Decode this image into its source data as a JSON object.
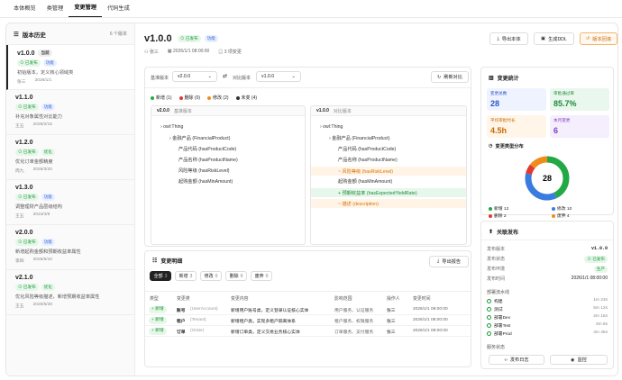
{
  "nav": {
    "tabs": [
      "本体概览",
      "类管理",
      "变更管理",
      "代码生成"
    ]
  },
  "sidebar": {
    "title": "版本历史",
    "count": "6 个版本",
    "versions": [
      {
        "name": "v1.0.0",
        "current": "当前",
        "status": "已发布",
        "tag": "功能",
        "desc": "初始版本，定义核心领域类",
        "author": "张三",
        "date": "2026/1/1"
      },
      {
        "name": "v1.1.0",
        "status": "已发布",
        "tag": "功能",
        "desc": "补充对象属性对比能力",
        "author": "王五",
        "date": "2026/2/15"
      },
      {
        "name": "v1.2.0",
        "status": "已发布",
        "tag": "优化",
        "desc": "优化订单金额精度",
        "author": "周九",
        "date": "2026/3/20"
      },
      {
        "name": "v1.3.0",
        "status": "已发布",
        "tag": "功能",
        "desc": "调整理财产品层级结构",
        "author": "王五",
        "date": "2024/4/8"
      },
      {
        "name": "v2.0.0",
        "status": "已发布",
        "tag": "功能",
        "desc": "新增起购金额和预期收益率属性",
        "author": "李四",
        "date": "2026/5/10"
      },
      {
        "name": "v2.1.0",
        "status": "已发布",
        "tag": "优化",
        "desc": "优化风险等级描述，新增预期收益率属性",
        "author": "王五",
        "date": "2026/5/28"
      }
    ]
  },
  "header": {
    "version": "v1.0.0",
    "status": "已发布",
    "tag": "功能",
    "author": "张三",
    "datetime": "2026/1/1 08:00:00",
    "changes": "3 项变更",
    "btn_export": "导出本体",
    "btn_gen": "生成DDL",
    "btn_rollback": "版本回滚"
  },
  "compare": {
    "base_label": "基准版本",
    "base_value": "v2.0.0",
    "target_label": "对比版本",
    "target_value": "v1.0.0",
    "refresh": "刷新对比",
    "legend": [
      {
        "label": "新增 (1)",
        "color": "#22a845"
      },
      {
        "label": "删除 (0)",
        "color": "#e0392f"
      },
      {
        "label": "修改 (2)",
        "color": "#f08c1a"
      },
      {
        "label": "未变 (4)",
        "color": "#333333"
      }
    ],
    "left": {
      "ver": "v2.0.0",
      "sub": "基准版本",
      "nodes": [
        "owl:Thing",
        "金融产品 (FinancialProduct)",
        "产品代码 (hasProductCode)",
        "产品名称 (hasProductName)",
        "风险等级 (hasRiskLevel)",
        "起购金额 (hasMinAmount)"
      ]
    },
    "right": {
      "ver": "v1.0.0",
      "sub": "对比版本",
      "nodes": [
        "owl:Thing",
        "金融产品 (FinancialProduct)",
        "产品代码 (hasProductCode)",
        "产品名称 (hasProductName)",
        "~ 风险等级 (hasRiskLevel)",
        "起购金额 (hasMinAmount)",
        "+ 预期收益率 (hasExpectedYieldRate)",
        "~ 描述 (description)"
      ]
    }
  },
  "changes": {
    "title": "变更明细",
    "export": "导出报告",
    "filters": [
      {
        "label": "全部",
        "count": "3"
      },
      {
        "label": "新增",
        "count": "3"
      },
      {
        "label": "修改",
        "count": "0"
      },
      {
        "label": "删除",
        "count": "0"
      },
      {
        "label": "废弃",
        "count": "0"
      }
    ],
    "headers": [
      "类型",
      "变更类",
      "变更内容",
      "影响范围",
      "操作人",
      "变更时间"
    ],
    "rows": [
      {
        "type": "+ 新增",
        "cls": "账号",
        "code": "(UserAccount)",
        "content": "新增用户账号类，定义登录认证核心实体",
        "impact": "用户服务、认证服务",
        "op": "张三",
        "time": "2026/1/1 08:00:00"
      },
      {
        "type": "+ 新增",
        "cls": "租户",
        "code": "(Tenant)",
        "content": "新增租户类，实现多租户隔离体系",
        "impact": "租户服务、权限服务",
        "op": "张三",
        "time": "2026/1/1 08:00:00"
      },
      {
        "type": "+ 新增",
        "cls": "订单",
        "code": "(Order)",
        "content": "新增订单类，定义交易业务核心实体",
        "impact": "订单服务、支付服务",
        "op": "张三",
        "time": "2026/1/1 08:00:00"
      }
    ]
  },
  "stats": {
    "title": "变更统计",
    "cards": [
      {
        "label": "变更总数",
        "value": "28",
        "bg": "#eef3ff",
        "color": "#2a55c8"
      },
      {
        "label": "审批通过率",
        "value": "85.7%",
        "bg": "#eaf7ee",
        "color": "#1a8a35"
      },
      {
        "label": "平均审批时长",
        "value": "4.5h",
        "bg": "#fff5e8",
        "color": "#c96a08"
      },
      {
        "label": "本月变更",
        "value": "6",
        "bg": "#f5eefc",
        "color": "#7a3fc4"
      }
    ],
    "dist_title": "变更类型分布",
    "total": "28",
    "dist": [
      {
        "label": "新增 12",
        "value": 12,
        "color": "#22a845"
      },
      {
        "label": "修改 10",
        "value": 10,
        "color": "#3a7be0"
      },
      {
        "label": "删除 2",
        "value": 2,
        "color": "#e0392f"
      },
      {
        "label": "废弃 4",
        "value": 4,
        "color": "#f08c1a"
      }
    ]
  },
  "release": {
    "title": "关联发布",
    "kv": [
      {
        "k": "发布版本",
        "v": "v1.0.0"
      },
      {
        "k": "发布状态",
        "v": "已发布"
      },
      {
        "k": "发布环境",
        "v": "生产"
      },
      {
        "k": "发布时间",
        "v": "2026/1/1 08:00:00"
      }
    ],
    "pipeline_title": "部署流水线",
    "steps": [
      {
        "name": "构建",
        "time": "1m 23s"
      },
      {
        "name": "测试",
        "time": "5m 12s"
      },
      {
        "name": "部署Dev",
        "time": "2m 15s"
      },
      {
        "name": "部署Test",
        "time": "3m 8s"
      },
      {
        "name": "部署Prod",
        "time": "4m 45s"
      }
    ],
    "service_title": "服务状态",
    "btn_log": "发布日志",
    "btn_monitor": "监控"
  }
}
